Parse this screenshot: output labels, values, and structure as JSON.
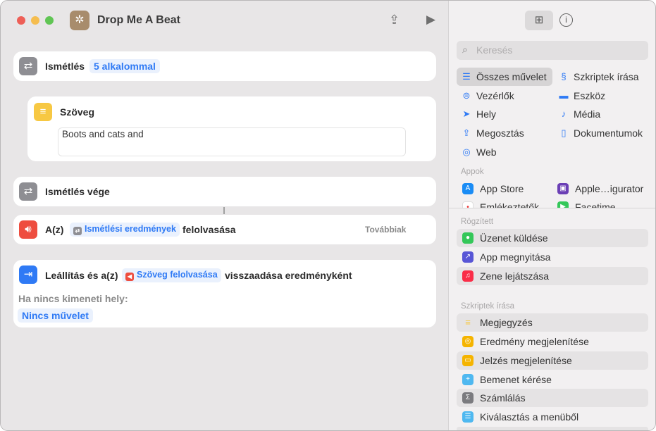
{
  "window": {
    "title": "Drop Me A Beat"
  },
  "editor": {
    "repeat": {
      "label": "Ismétlés",
      "count": "5 alkalommal"
    },
    "text": {
      "label": "Szöveg",
      "value": "Boots and cats and"
    },
    "end_repeat": {
      "label": "Ismétlés vége"
    },
    "speak": {
      "prefix": "A(z)",
      "token": "Ismétlési eredmények",
      "suffix": "felolvasása",
      "more": "Továbbiak"
    },
    "stop": {
      "prefix": "Leállítás és a(z)",
      "token": "Szöveg felolvasása",
      "suffix": "visszaadása eredményként",
      "no_output_label": "Ha nincs kimeneti hely:",
      "no_output_value": "Nincs művelet"
    }
  },
  "library": {
    "search_placeholder": "Keresés",
    "categories": [
      {
        "label": "Összes művelet",
        "icon": "list-icon"
      },
      {
        "label": "Szkriptek írása",
        "icon": "scripting-icon"
      },
      {
        "label": "Vezérlők",
        "icon": "toggle-icon"
      },
      {
        "label": "Eszköz",
        "icon": "display-icon"
      },
      {
        "label": "Hely",
        "icon": "location-icon"
      },
      {
        "label": "Média",
        "icon": "music-note-icon"
      },
      {
        "label": "Megosztás",
        "icon": "share-icon"
      },
      {
        "label": "Dokumentumok",
        "icon": "document-icon"
      },
      {
        "label": "Web",
        "icon": "compass-icon"
      }
    ],
    "apps_header": "Appok",
    "apps": [
      {
        "label": "App Store"
      },
      {
        "label": "Apple…igurator"
      },
      {
        "label": "Emlékeztetők"
      },
      {
        "label": "Facetime"
      }
    ],
    "pinned_header": "Rögzített",
    "pinned": [
      {
        "label": "Üzenet küldése",
        "color": "#34c759"
      },
      {
        "label": "App megnyitása",
        "color": "#5856d6"
      },
      {
        "label": "Zene lejátszása",
        "color": "#fa2d48"
      }
    ],
    "scripting_header": "Szkriptek írása",
    "scripting": [
      {
        "label": "Megjegyzés",
        "color": "#f7c843"
      },
      {
        "label": "Eredmény megjelenítése",
        "color": "#f5b400"
      },
      {
        "label": "Jelzés megjelenítése",
        "color": "#f5b400"
      },
      {
        "label": "Bemenet kérése",
        "color": "#4fb8f0"
      },
      {
        "label": "Számlálás",
        "color": "#7b7b7f"
      },
      {
        "label": "Kiválasztás a menüből",
        "color": "#4fb8f0"
      }
    ]
  }
}
